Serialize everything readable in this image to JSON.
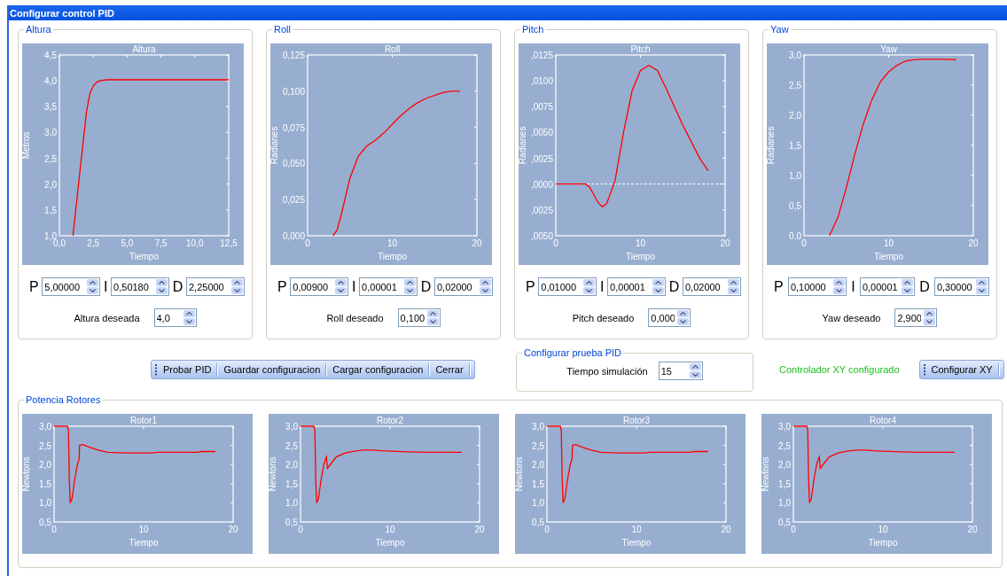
{
  "window": {
    "title": "Configurar control PID"
  },
  "panels": [
    {
      "title": "Altura",
      "chart_data": {
        "type": "line",
        "title": "Altura",
        "xlabel": "Tiempo",
        "ylabel": "Metros",
        "xlim": [
          0,
          12.5
        ],
        "ylim": [
          1,
          4.5
        ],
        "xticks": [
          {
            "value": 0,
            "label": "0,0"
          },
          {
            "value": 2.5,
            "label": "2,5"
          },
          {
            "value": 5,
            "label": "5,0"
          },
          {
            "value": 7.5,
            "label": "7,5"
          },
          {
            "value": 10,
            "label": "10,0"
          },
          {
            "value": 12.5,
            "label": "12,5"
          }
        ],
        "yticks": [
          {
            "value": 1,
            "label": "1,0"
          },
          {
            "value": 1.5,
            "label": "1,5"
          },
          {
            "value": 2,
            "label": "2,0"
          },
          {
            "value": 2.5,
            "label": "2,5"
          },
          {
            "value": 3,
            "label": "3,0"
          },
          {
            "value": 3.5,
            "label": "3,5"
          },
          {
            "value": 4,
            "label": "4,0"
          },
          {
            "value": 4.5,
            "label": "4,5"
          }
        ],
        "x": [
          1,
          1.5,
          2,
          2.25,
          2.5,
          2.75,
          3,
          3.5,
          4,
          6,
          8,
          10,
          12.5
        ],
        "series": [
          {
            "color": "#ff0000",
            "values": [
              1.0,
              2.2,
              3.4,
              3.75,
              3.9,
              3.97,
              4.0,
              4.02,
              4.02,
              4.02,
              4.02,
              4.02,
              4.02
            ]
          }
        ]
      },
      "pid": [
        {
          "label": "P",
          "value": "5,00000"
        },
        {
          "label": "I",
          "value": "0,50180"
        },
        {
          "label": "D",
          "value": "2,25000"
        }
      ],
      "setpoint": {
        "label": "Altura deseada",
        "value": "4,0"
      }
    },
    {
      "title": "Roll",
      "chart_data": {
        "type": "line",
        "title": "Roll",
        "xlabel": "Tiempo",
        "ylabel": "Radianes",
        "xlim": [
          0,
          20
        ],
        "ylim": [
          0,
          0.125
        ],
        "xticks": [
          0,
          10,
          20
        ],
        "yticks": [
          {
            "value": 0,
            "label": "0,000"
          },
          {
            "value": 0.025,
            "label": "0,025"
          },
          {
            "value": 0.05,
            "label": "0,050"
          },
          {
            "value": 0.075,
            "label": "0,075"
          },
          {
            "value": 0.1,
            "label": "0,100"
          },
          {
            "value": 0.125,
            "label": "0,125"
          }
        ],
        "x": [
          3,
          3.5,
          4,
          5,
          6,
          7,
          8,
          9,
          10,
          11,
          12,
          13,
          14,
          15,
          16,
          17,
          18
        ],
        "series": [
          {
            "color": "#ff0000",
            "values": [
              0,
              0.004,
              0.015,
              0.04,
              0.055,
              0.062,
              0.066,
              0.071,
              0.077,
              0.083,
              0.088,
              0.092,
              0.095,
              0.097,
              0.099,
              0.1,
              0.1
            ]
          }
        ]
      },
      "pid": [
        {
          "label": "P",
          "value": "0,00900"
        },
        {
          "label": "I",
          "value": "0,00001"
        },
        {
          "label": "D",
          "value": "0,02000"
        }
      ],
      "setpoint": {
        "label": "Roll deseado",
        "value": "0,100"
      }
    },
    {
      "title": "Pitch",
      "chart_data": {
        "type": "line",
        "title": "Pitch",
        "xlabel": "Tiempo",
        "ylabel": "Radianes",
        "xlim": [
          0,
          20
        ],
        "ylim": [
          -50,
          125
        ],
        "xticks": [
          0,
          10,
          20
        ],
        "yticks": [
          {
            "value": -50,
            "label": ",0050"
          },
          {
            "value": -25,
            "label": ",0025"
          },
          {
            "value": 0,
            "label": ",0000"
          },
          {
            "value": 25,
            "label": ",0025"
          },
          {
            "value": 50,
            "label": ",0050"
          },
          {
            "value": 75,
            "label": ",0075"
          },
          {
            "value": 100,
            "label": ",0100"
          },
          {
            "value": 125,
            "label": ",0125"
          }
        ],
        "x": [
          0,
          3.5,
          4,
          5,
          5.5,
          6,
          7,
          8,
          9,
          10,
          11,
          12,
          13,
          14,
          15,
          16,
          17,
          18
        ],
        "series": [
          {
            "color": "#ff0000",
            "values": [
              0,
              0,
              -3,
              -18,
              -22,
              -19,
              3,
              50,
              90,
              110,
              115,
              110,
              93,
              75,
              57,
              41,
              25,
              13
            ]
          }
        ],
        "ref_lines": [
          {
            "axis": "y",
            "value": 0
          }
        ]
      },
      "pid": [
        {
          "label": "P",
          "value": "0,01000"
        },
        {
          "label": "I",
          "value": "0,00001"
        },
        {
          "label": "D",
          "value": "0,02000"
        }
      ],
      "setpoint": {
        "label": "Pitch deseado",
        "value": "0,000"
      }
    },
    {
      "title": "Yaw",
      "chart_data": {
        "type": "line",
        "title": "Yaw",
        "xlabel": "Tiempo",
        "ylabel": "Radianes",
        "xlim": [
          0,
          20
        ],
        "ylim": [
          0,
          3
        ],
        "xticks": [
          0,
          10,
          20
        ],
        "yticks": [
          {
            "value": 0,
            "label": "0,0"
          },
          {
            "value": 0.5,
            "label": "0,5"
          },
          {
            "value": 1,
            "label": "1,0"
          },
          {
            "value": 1.5,
            "label": "1,5"
          },
          {
            "value": 2,
            "label": "2,0"
          },
          {
            "value": 2.5,
            "label": "2,5"
          },
          {
            "value": 3,
            "label": "3,0"
          }
        ],
        "x": [
          3,
          4,
          5,
          6,
          7,
          8,
          9,
          10,
          11,
          12,
          13,
          14,
          16,
          18
        ],
        "series": [
          {
            "color": "#ff0000",
            "values": [
              0,
              0.3,
              0.8,
              1.35,
              1.85,
              2.25,
              2.55,
              2.72,
              2.83,
              2.9,
              2.92,
              2.93,
              2.93,
              2.92
            ]
          }
        ]
      },
      "pid": [
        {
          "label": "P",
          "value": "0,10000"
        },
        {
          "label": "I",
          "value": "0,00001"
        },
        {
          "label": "D",
          "value": "0,30000"
        }
      ],
      "setpoint": {
        "label": "Yaw deseado",
        "value": "2,900"
      }
    }
  ],
  "toolbar": {
    "buttons": [
      "Probar PID",
      "Guardar configuracion",
      "Cargar configuracion",
      "Cerrar"
    ]
  },
  "test_config": {
    "title": "Configurar prueba PID",
    "label": "Tiempo simulación",
    "value": "15"
  },
  "xy": {
    "status": "Controlador XY configurado",
    "button": "Configurar XY"
  },
  "rotors": {
    "title": "Potencia Rotores",
    "charts": [
      {
        "chart_data": {
          "type": "line",
          "title": "Rotor1",
          "xlabel": "Tiempo",
          "ylabel": "Newtons",
          "xlim": [
            0,
            20
          ],
          "ylim": [
            0.5,
            3
          ],
          "xticks": [
            0,
            10,
            20
          ],
          "yticks": [
            {
              "value": 0.5,
              "label": "0,5"
            },
            {
              "value": 1,
              "label": "1,0"
            },
            {
              "value": 1.5,
              "label": "1,5"
            },
            {
              "value": 2,
              "label": "2,0"
            },
            {
              "value": 2.5,
              "label": "2,5"
            },
            {
              "value": 3,
              "label": "3,0"
            }
          ],
          "x": [
            0,
            1.5,
            1.6,
            1.7,
            1.8,
            2,
            2.3,
            2.6,
            2.8,
            2.85,
            3.2,
            4,
            5,
            6,
            8,
            11,
            11.5,
            16,
            16.5,
            18
          ],
          "series": [
            {
              "color": "#ff0000",
              "values": [
                3,
                3,
                2.9,
                1.6,
                1.0,
                1.1,
                1.6,
                2.0,
                2.15,
                2.5,
                2.52,
                2.45,
                2.37,
                2.32,
                2.3,
                2.3,
                2.32,
                2.32,
                2.34,
                2.34
              ]
            }
          ]
        }
      },
      {
        "chart_data": {
          "type": "line",
          "title": "Rotor2",
          "xlabel": "Tiempo",
          "ylabel": "Newtons",
          "xlim": [
            0,
            20
          ],
          "ylim": [
            0.5,
            3
          ],
          "xticks": [
            0,
            10,
            20
          ],
          "yticks": [
            {
              "value": 0.5,
              "label": "0,5"
            },
            {
              "value": 1,
              "label": "1,0"
            },
            {
              "value": 1.5,
              "label": "1,5"
            },
            {
              "value": 2,
              "label": "2,0"
            },
            {
              "value": 2.5,
              "label": "2,5"
            },
            {
              "value": 3,
              "label": "3,0"
            }
          ],
          "x": [
            0,
            1.5,
            1.6,
            1.7,
            1.8,
            2,
            2.3,
            2.6,
            2.8,
            2.9,
            3,
            3.5,
            4,
            5,
            6,
            7,
            8,
            9,
            10,
            12,
            14,
            18
          ],
          "series": [
            {
              "color": "#ff0000",
              "values": [
                3,
                3,
                2.9,
                1.6,
                1.0,
                1.1,
                1.6,
                2.0,
                2.15,
                2.2,
                1.9,
                2.05,
                2.2,
                2.3,
                2.35,
                2.38,
                2.38,
                2.36,
                2.35,
                2.33,
                2.32,
                2.32
              ]
            }
          ]
        }
      },
      {
        "chart_data": {
          "type": "line",
          "title": "Rotor3",
          "xlabel": "Tiempo",
          "ylabel": "Newtons",
          "xlim": [
            0,
            20
          ],
          "ylim": [
            0.5,
            3
          ],
          "xticks": [
            0,
            10,
            20
          ],
          "yticks": [
            {
              "value": 0.5,
              "label": "0,5"
            },
            {
              "value": 1,
              "label": "1,0"
            },
            {
              "value": 1.5,
              "label": "1,5"
            },
            {
              "value": 2,
              "label": "2,0"
            },
            {
              "value": 2.5,
              "label": "2,5"
            },
            {
              "value": 3,
              "label": "3,0"
            }
          ],
          "x": [
            0,
            1.5,
            1.6,
            1.7,
            1.8,
            2,
            2.3,
            2.6,
            2.8,
            2.85,
            3.2,
            4,
            5,
            6,
            8,
            11,
            11.5,
            16,
            16.5,
            18
          ],
          "series": [
            {
              "color": "#ff0000",
              "values": [
                3,
                3,
                2.9,
                1.6,
                1.0,
                1.1,
                1.6,
                2.0,
                2.15,
                2.5,
                2.52,
                2.45,
                2.37,
                2.32,
                2.3,
                2.3,
                2.32,
                2.32,
                2.34,
                2.34
              ]
            }
          ]
        }
      },
      {
        "chart_data": {
          "type": "line",
          "title": "Rotor4",
          "xlabel": "Tiempo",
          "ylabel": "Newtons",
          "xlim": [
            0,
            20
          ],
          "ylim": [
            0.5,
            3
          ],
          "xticks": [
            0,
            10,
            20
          ],
          "yticks": [
            {
              "value": 0.5,
              "label": "0,5"
            },
            {
              "value": 1,
              "label": "1,0"
            },
            {
              "value": 1.5,
              "label": "1,5"
            },
            {
              "value": 2,
              "label": "2,0"
            },
            {
              "value": 2.5,
              "label": "2,5"
            },
            {
              "value": 3,
              "label": "3,0"
            }
          ],
          "x": [
            0,
            1.5,
            1.6,
            1.7,
            1.8,
            2,
            2.3,
            2.6,
            2.8,
            2.9,
            3,
            3.5,
            4,
            5,
            6,
            7,
            8,
            9,
            10,
            12,
            14,
            18
          ],
          "series": [
            {
              "color": "#ff0000",
              "values": [
                3,
                3,
                2.9,
                1.6,
                1.0,
                1.1,
                1.6,
                2.0,
                2.15,
                2.2,
                1.9,
                2.05,
                2.2,
                2.3,
                2.35,
                2.38,
                2.38,
                2.36,
                2.35,
                2.33,
                2.32,
                2.32
              ]
            }
          ]
        }
      }
    ]
  }
}
